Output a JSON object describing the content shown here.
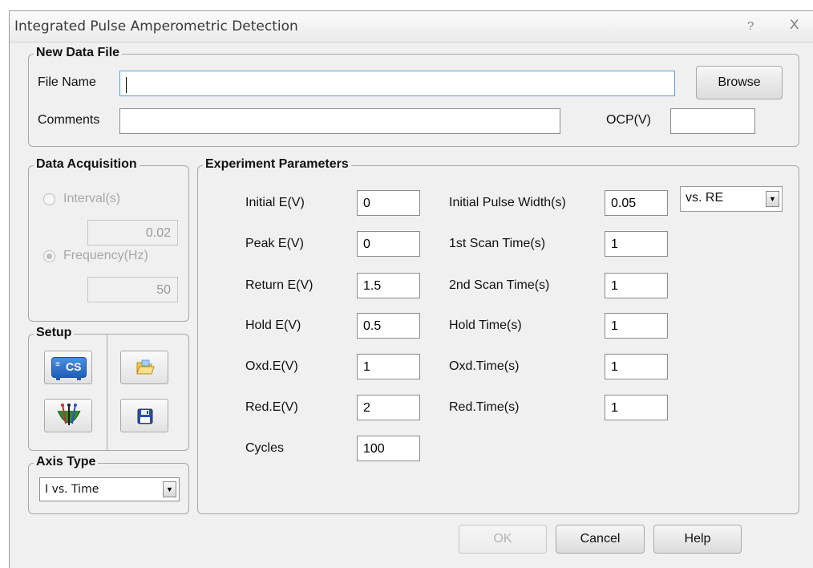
{
  "window": {
    "title": "Integrated Pulse Amperometric Detection",
    "help_glyph": "?",
    "close_glyph": "X"
  },
  "new_data_file": {
    "legend": "New Data File",
    "file_name_label": "File Name",
    "file_name_value": "",
    "browse_label": "Browse",
    "comments_label": "Comments",
    "comments_value": "",
    "ocp_label": "OCP(V)",
    "ocp_value": ""
  },
  "data_acquisition": {
    "legend": "Data Acquisition",
    "interval_label": "Interval(s)",
    "interval_value": "0.02",
    "interval_selected": false,
    "frequency_label": "Frequency(Hz)",
    "frequency_value": "50",
    "frequency_selected": true
  },
  "setup": {
    "legend": "Setup",
    "icons": [
      "cs-instrument-icon",
      "electrode-cell-icon",
      "open-folder-icon",
      "save-disk-icon"
    ],
    "cs_text": "CS"
  },
  "axis_type": {
    "legend": "Axis Type",
    "selected": "I vs. Time"
  },
  "experiment_parameters": {
    "legend": "Experiment Parameters",
    "left": [
      {
        "label": "Initial E(V)",
        "value": "0"
      },
      {
        "label": "Peak E(V)",
        "value": "0"
      },
      {
        "label": "Return E(V)",
        "value": "1.5"
      },
      {
        "label": "Hold E(V)",
        "value": "0.5"
      },
      {
        "label": "Oxd.E(V)",
        "value": "1"
      },
      {
        "label": "Red.E(V)",
        "value": "2"
      },
      {
        "label": "Cycles",
        "value": "100"
      }
    ],
    "right": [
      {
        "label": "Initial Pulse Width(s)",
        "value": "0.05"
      },
      {
        "label": "1st Scan Time(s)",
        "value": "1"
      },
      {
        "label": "2nd Scan Time(s)",
        "value": "1"
      },
      {
        "label": "Hold Time(s)",
        "value": "1"
      },
      {
        "label": "Oxd.Time(s)",
        "value": "1"
      },
      {
        "label": "Red.Time(s)",
        "value": "1"
      }
    ],
    "reference_select": "vs. RE"
  },
  "footer": {
    "ok_label": "OK",
    "cancel_label": "Cancel",
    "help_label": "Help"
  }
}
